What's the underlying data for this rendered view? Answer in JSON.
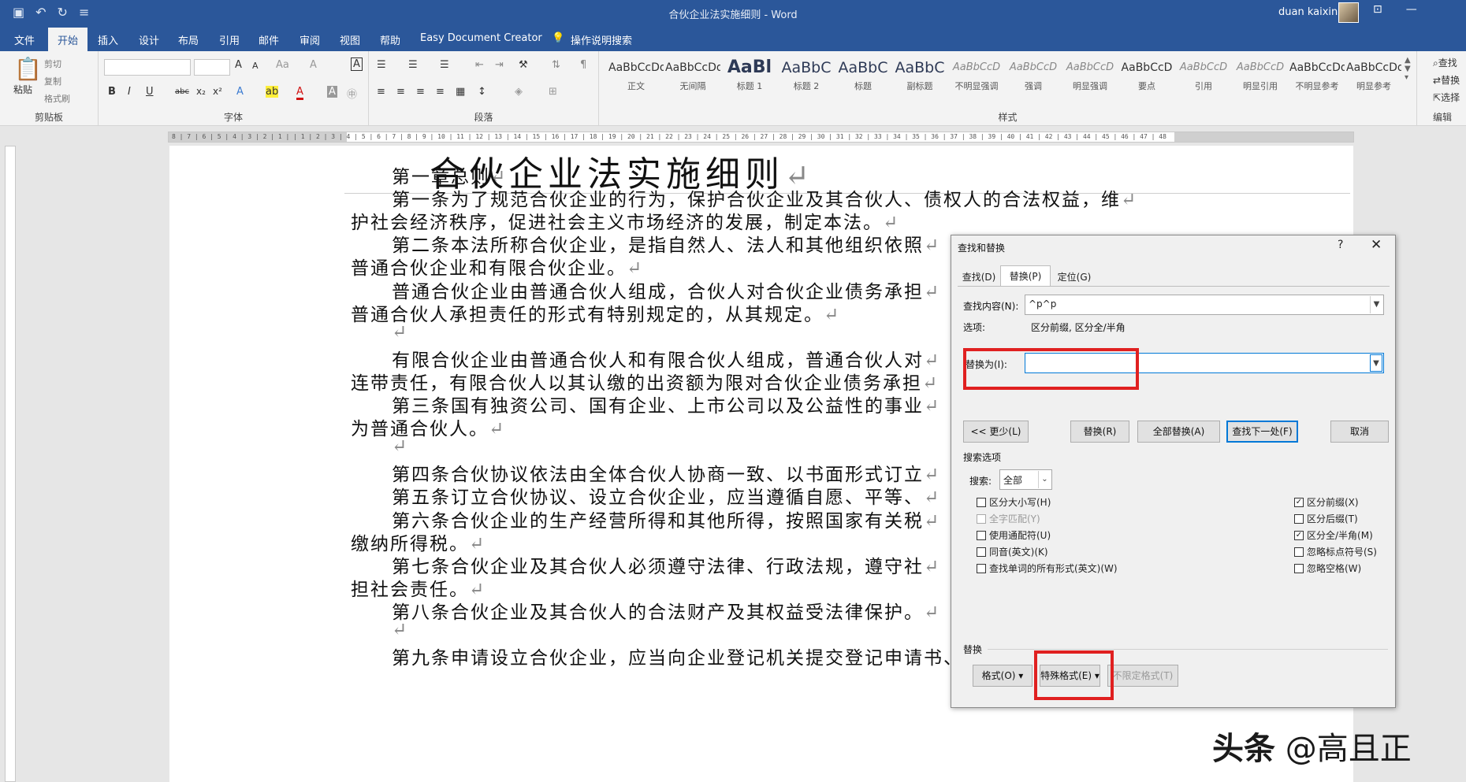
{
  "window": {
    "title": "合伙企业法实施细则 - Word",
    "user": "duan kaixin"
  },
  "tabs": [
    "文件",
    "开始",
    "插入",
    "设计",
    "布局",
    "引用",
    "邮件",
    "审阅",
    "视图",
    "帮助",
    "Easy Document Creator",
    "操作说明搜索"
  ],
  "ribbon": {
    "clipboard": {
      "paste": "粘贴",
      "cut": "剪切",
      "copy": "复制",
      "format_painter": "格式刷",
      "label": "剪贴板"
    },
    "font": {
      "label": "字体",
      "bold": "B",
      "italic": "I",
      "underline": "U",
      "strike": "abc",
      "sub": "x₂",
      "sup": "x²",
      "grow": "A",
      "shrink": "A",
      "case": "Aa",
      "clear": "A",
      "border": "A"
    },
    "paragraph": {
      "label": "段落"
    },
    "styles": {
      "label": "样式",
      "items": [
        {
          "preview": "AaBbCcDd",
          "name": "正文"
        },
        {
          "preview": "AaBbCcDd",
          "name": "无间隔"
        },
        {
          "preview": "AaBl",
          "name": "标题 1"
        },
        {
          "preview": "AaBbC",
          "name": "标题 2"
        },
        {
          "preview": "AaBbC",
          "name": "标题"
        },
        {
          "preview": "AaBbC",
          "name": "副标题"
        },
        {
          "preview": "AaBbCcD",
          "name": "不明显强调"
        },
        {
          "preview": "AaBbCcD",
          "name": "强调"
        },
        {
          "preview": "AaBbCcD",
          "name": "明显强调"
        },
        {
          "preview": "AaBbCcD",
          "name": "要点"
        },
        {
          "preview": "AaBbCcD",
          "name": "引用"
        },
        {
          "preview": "AaBbCcD",
          "name": "明显引用"
        },
        {
          "preview": "AaBbCcDd",
          "name": "不明显参考"
        },
        {
          "preview": "AaBbCcDd",
          "name": "明显参考"
        }
      ]
    },
    "editing": {
      "find": "查找",
      "replace": "替换",
      "select": "选择",
      "label": "编辑"
    }
  },
  "ruler": {
    "text": "8 | 7 | 6 | 5 | 4 | 3 | 2 | 1 |    | 1 | 2 | 3 | 4 | 5 | 6 | 7 | 8 | 9 | 10 | 11 | 12 | 13 | 14 | 15 | 16 | 17 | 18 | 19 | 20 | 21 | 22 | 23 | 24 | 25 | 26 | 27 | 28 | 29 | 30 | 31 | 32 | 33 | 34 | 35 | 36 | 37 | 38 | 39 | 40 | 41 | 42 | 43 | 44 | 45 | 46 | 47 | 48"
  },
  "document": {
    "title": "合伙企业法实施细则",
    "lines": [
      {
        "text": "第一章总则",
        "indent": true
      },
      {
        "text": "第一条为了规范合伙企业的行为，保护合伙企业及其合伙人、债权人的合法权益，维",
        "indent": true
      },
      {
        "text": "护社会经济秩序，促进社会主义市场经济的发展，制定本法。",
        "indent": false
      },
      {
        "text": "第二条本法所称合伙企业，是指自然人、法人和其他组织依照",
        "indent": true
      },
      {
        "text": "普通合伙企业和有限合伙企业。",
        "indent": false
      },
      {
        "text": "普通合伙企业由普通合伙人组成，合伙人对合伙企业债务承担",
        "indent": true
      },
      {
        "text": "普通合伙人承担责任的形式有特别规定的，从其规定。",
        "indent": false
      },
      {
        "text": "",
        "indent": true
      },
      {
        "text": "有限合伙企业由普通合伙人和有限合伙人组成，普通合伙人对",
        "indent": true
      },
      {
        "text": "连带责任，有限合伙人以其认缴的出资额为限对合伙企业债务承担",
        "indent": false
      },
      {
        "text": "第三条国有独资公司、国有企业、上市公司以及公益性的事业",
        "indent": true
      },
      {
        "text": "为普通合伙人。",
        "indent": false
      },
      {
        "text": "",
        "indent": true
      },
      {
        "text": "第四条合伙协议依法由全体合伙人协商一致、以书面形式订立",
        "indent": true
      },
      {
        "text": "第五条订立合伙协议、设立合伙企业，应当遵循自愿、平等、",
        "indent": true
      },
      {
        "text": "第六条合伙企业的生产经营所得和其他所得，按照国家有关税",
        "indent": true
      },
      {
        "text": "缴纳所得税。",
        "indent": false
      },
      {
        "text": "第七条合伙企业及其合伙人必须遵守法律、行政法规，遵守社",
        "indent": true
      },
      {
        "text": "担社会责任。",
        "indent": false
      },
      {
        "text": "第八条合伙企业及其合伙人的合法财产及其权益受法律保护。",
        "indent": true
      },
      {
        "text": "",
        "indent": true
      },
      {
        "text": "第九条申请设立合伙企业，应当向企业登记机关提交登记申请书、合伙协议书、合伙",
        "indent": true
      }
    ],
    "paragraph_mark": "↵"
  },
  "dialog": {
    "title": "查找和替换",
    "help": "?",
    "close": "✕",
    "tabs": [
      "查找(D)",
      "替换(P)",
      "定位(G)"
    ],
    "find_label": "查找内容(N):",
    "find_value": "^p^p",
    "options_label": "选项:",
    "options_value": "区分前缀, 区分全/半角",
    "replace_label": "替换为(I):",
    "replace_value": "",
    "buttons": {
      "less": "<< 更少(L)",
      "replace": "替换(R)",
      "replace_all": "全部替换(A)",
      "find_next": "查找下一处(F)",
      "cancel": "取消"
    },
    "search_options_title": "搜索选项",
    "search_label": "搜索:",
    "search_value": "全部",
    "left_checks": [
      {
        "label": "区分大小写(H)",
        "checked": false,
        "disabled": false
      },
      {
        "label": "全字匹配(Y)",
        "checked": false,
        "disabled": true
      },
      {
        "label": "使用通配符(U)",
        "checked": false,
        "disabled": false
      },
      {
        "label": "同音(英文)(K)",
        "checked": false,
        "disabled": false
      },
      {
        "label": "查找单词的所有形式(英文)(W)",
        "checked": false,
        "disabled": false
      }
    ],
    "right_checks": [
      {
        "label": "区分前缀(X)",
        "checked": true,
        "disabled": false
      },
      {
        "label": "区分后缀(T)",
        "checked": false,
        "disabled": false
      },
      {
        "label": "区分全/半角(M)",
        "checked": true,
        "disabled": false
      },
      {
        "label": "忽略标点符号(S)",
        "checked": false,
        "disabled": false
      },
      {
        "label": "忽略空格(W)",
        "checked": false,
        "disabled": false
      }
    ],
    "replace_section_title": "替换",
    "format_button": "格式(O) ▾",
    "special_button": "特殊格式(E) ▾",
    "no_format_button": "不限定格式(T)"
  },
  "watermark": {
    "brand": "头条",
    "handle": "@高且正"
  },
  "colors": {
    "word_blue": "#2b579a",
    "highlight_red": "#e02020",
    "focus_blue": "#0078d7"
  }
}
